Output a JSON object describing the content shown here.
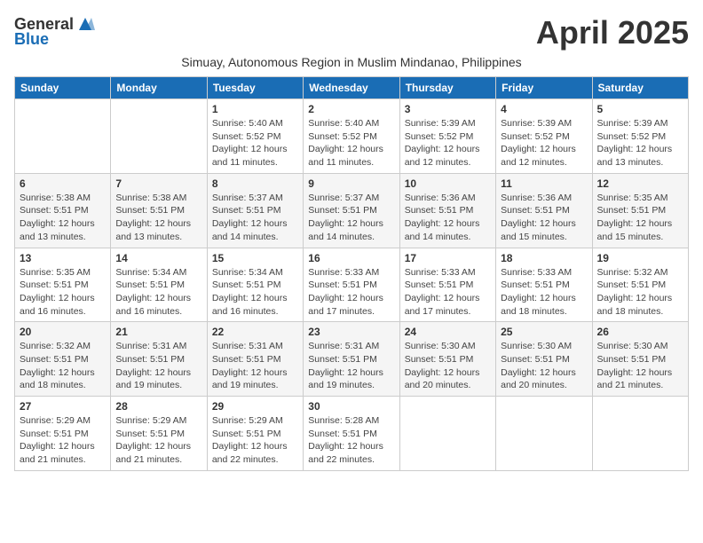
{
  "header": {
    "logo_general": "General",
    "logo_blue": "Blue",
    "month_title": "April 2025",
    "subtitle": "Simuay, Autonomous Region in Muslim Mindanao, Philippines"
  },
  "days_of_week": [
    "Sunday",
    "Monday",
    "Tuesday",
    "Wednesday",
    "Thursday",
    "Friday",
    "Saturday"
  ],
  "weeks": [
    [
      {
        "day": "",
        "info": ""
      },
      {
        "day": "",
        "info": ""
      },
      {
        "day": "1",
        "info": "Sunrise: 5:40 AM\nSunset: 5:52 PM\nDaylight: 12 hours and 11 minutes."
      },
      {
        "day": "2",
        "info": "Sunrise: 5:40 AM\nSunset: 5:52 PM\nDaylight: 12 hours and 11 minutes."
      },
      {
        "day": "3",
        "info": "Sunrise: 5:39 AM\nSunset: 5:52 PM\nDaylight: 12 hours and 12 minutes."
      },
      {
        "day": "4",
        "info": "Sunrise: 5:39 AM\nSunset: 5:52 PM\nDaylight: 12 hours and 12 minutes."
      },
      {
        "day": "5",
        "info": "Sunrise: 5:39 AM\nSunset: 5:52 PM\nDaylight: 12 hours and 13 minutes."
      }
    ],
    [
      {
        "day": "6",
        "info": "Sunrise: 5:38 AM\nSunset: 5:51 PM\nDaylight: 12 hours and 13 minutes."
      },
      {
        "day": "7",
        "info": "Sunrise: 5:38 AM\nSunset: 5:51 PM\nDaylight: 12 hours and 13 minutes."
      },
      {
        "day": "8",
        "info": "Sunrise: 5:37 AM\nSunset: 5:51 PM\nDaylight: 12 hours and 14 minutes."
      },
      {
        "day": "9",
        "info": "Sunrise: 5:37 AM\nSunset: 5:51 PM\nDaylight: 12 hours and 14 minutes."
      },
      {
        "day": "10",
        "info": "Sunrise: 5:36 AM\nSunset: 5:51 PM\nDaylight: 12 hours and 14 minutes."
      },
      {
        "day": "11",
        "info": "Sunrise: 5:36 AM\nSunset: 5:51 PM\nDaylight: 12 hours and 15 minutes."
      },
      {
        "day": "12",
        "info": "Sunrise: 5:35 AM\nSunset: 5:51 PM\nDaylight: 12 hours and 15 minutes."
      }
    ],
    [
      {
        "day": "13",
        "info": "Sunrise: 5:35 AM\nSunset: 5:51 PM\nDaylight: 12 hours and 16 minutes."
      },
      {
        "day": "14",
        "info": "Sunrise: 5:34 AM\nSunset: 5:51 PM\nDaylight: 12 hours and 16 minutes."
      },
      {
        "day": "15",
        "info": "Sunrise: 5:34 AM\nSunset: 5:51 PM\nDaylight: 12 hours and 16 minutes."
      },
      {
        "day": "16",
        "info": "Sunrise: 5:33 AM\nSunset: 5:51 PM\nDaylight: 12 hours and 17 minutes."
      },
      {
        "day": "17",
        "info": "Sunrise: 5:33 AM\nSunset: 5:51 PM\nDaylight: 12 hours and 17 minutes."
      },
      {
        "day": "18",
        "info": "Sunrise: 5:33 AM\nSunset: 5:51 PM\nDaylight: 12 hours and 18 minutes."
      },
      {
        "day": "19",
        "info": "Sunrise: 5:32 AM\nSunset: 5:51 PM\nDaylight: 12 hours and 18 minutes."
      }
    ],
    [
      {
        "day": "20",
        "info": "Sunrise: 5:32 AM\nSunset: 5:51 PM\nDaylight: 12 hours and 18 minutes."
      },
      {
        "day": "21",
        "info": "Sunrise: 5:31 AM\nSunset: 5:51 PM\nDaylight: 12 hours and 19 minutes."
      },
      {
        "day": "22",
        "info": "Sunrise: 5:31 AM\nSunset: 5:51 PM\nDaylight: 12 hours and 19 minutes."
      },
      {
        "day": "23",
        "info": "Sunrise: 5:31 AM\nSunset: 5:51 PM\nDaylight: 12 hours and 19 minutes."
      },
      {
        "day": "24",
        "info": "Sunrise: 5:30 AM\nSunset: 5:51 PM\nDaylight: 12 hours and 20 minutes."
      },
      {
        "day": "25",
        "info": "Sunrise: 5:30 AM\nSunset: 5:51 PM\nDaylight: 12 hours and 20 minutes."
      },
      {
        "day": "26",
        "info": "Sunrise: 5:30 AM\nSunset: 5:51 PM\nDaylight: 12 hours and 21 minutes."
      }
    ],
    [
      {
        "day": "27",
        "info": "Sunrise: 5:29 AM\nSunset: 5:51 PM\nDaylight: 12 hours and 21 minutes."
      },
      {
        "day": "28",
        "info": "Sunrise: 5:29 AM\nSunset: 5:51 PM\nDaylight: 12 hours and 21 minutes."
      },
      {
        "day": "29",
        "info": "Sunrise: 5:29 AM\nSunset: 5:51 PM\nDaylight: 12 hours and 22 minutes."
      },
      {
        "day": "30",
        "info": "Sunrise: 5:28 AM\nSunset: 5:51 PM\nDaylight: 12 hours and 22 minutes."
      },
      {
        "day": "",
        "info": ""
      },
      {
        "day": "",
        "info": ""
      },
      {
        "day": "",
        "info": ""
      }
    ]
  ]
}
